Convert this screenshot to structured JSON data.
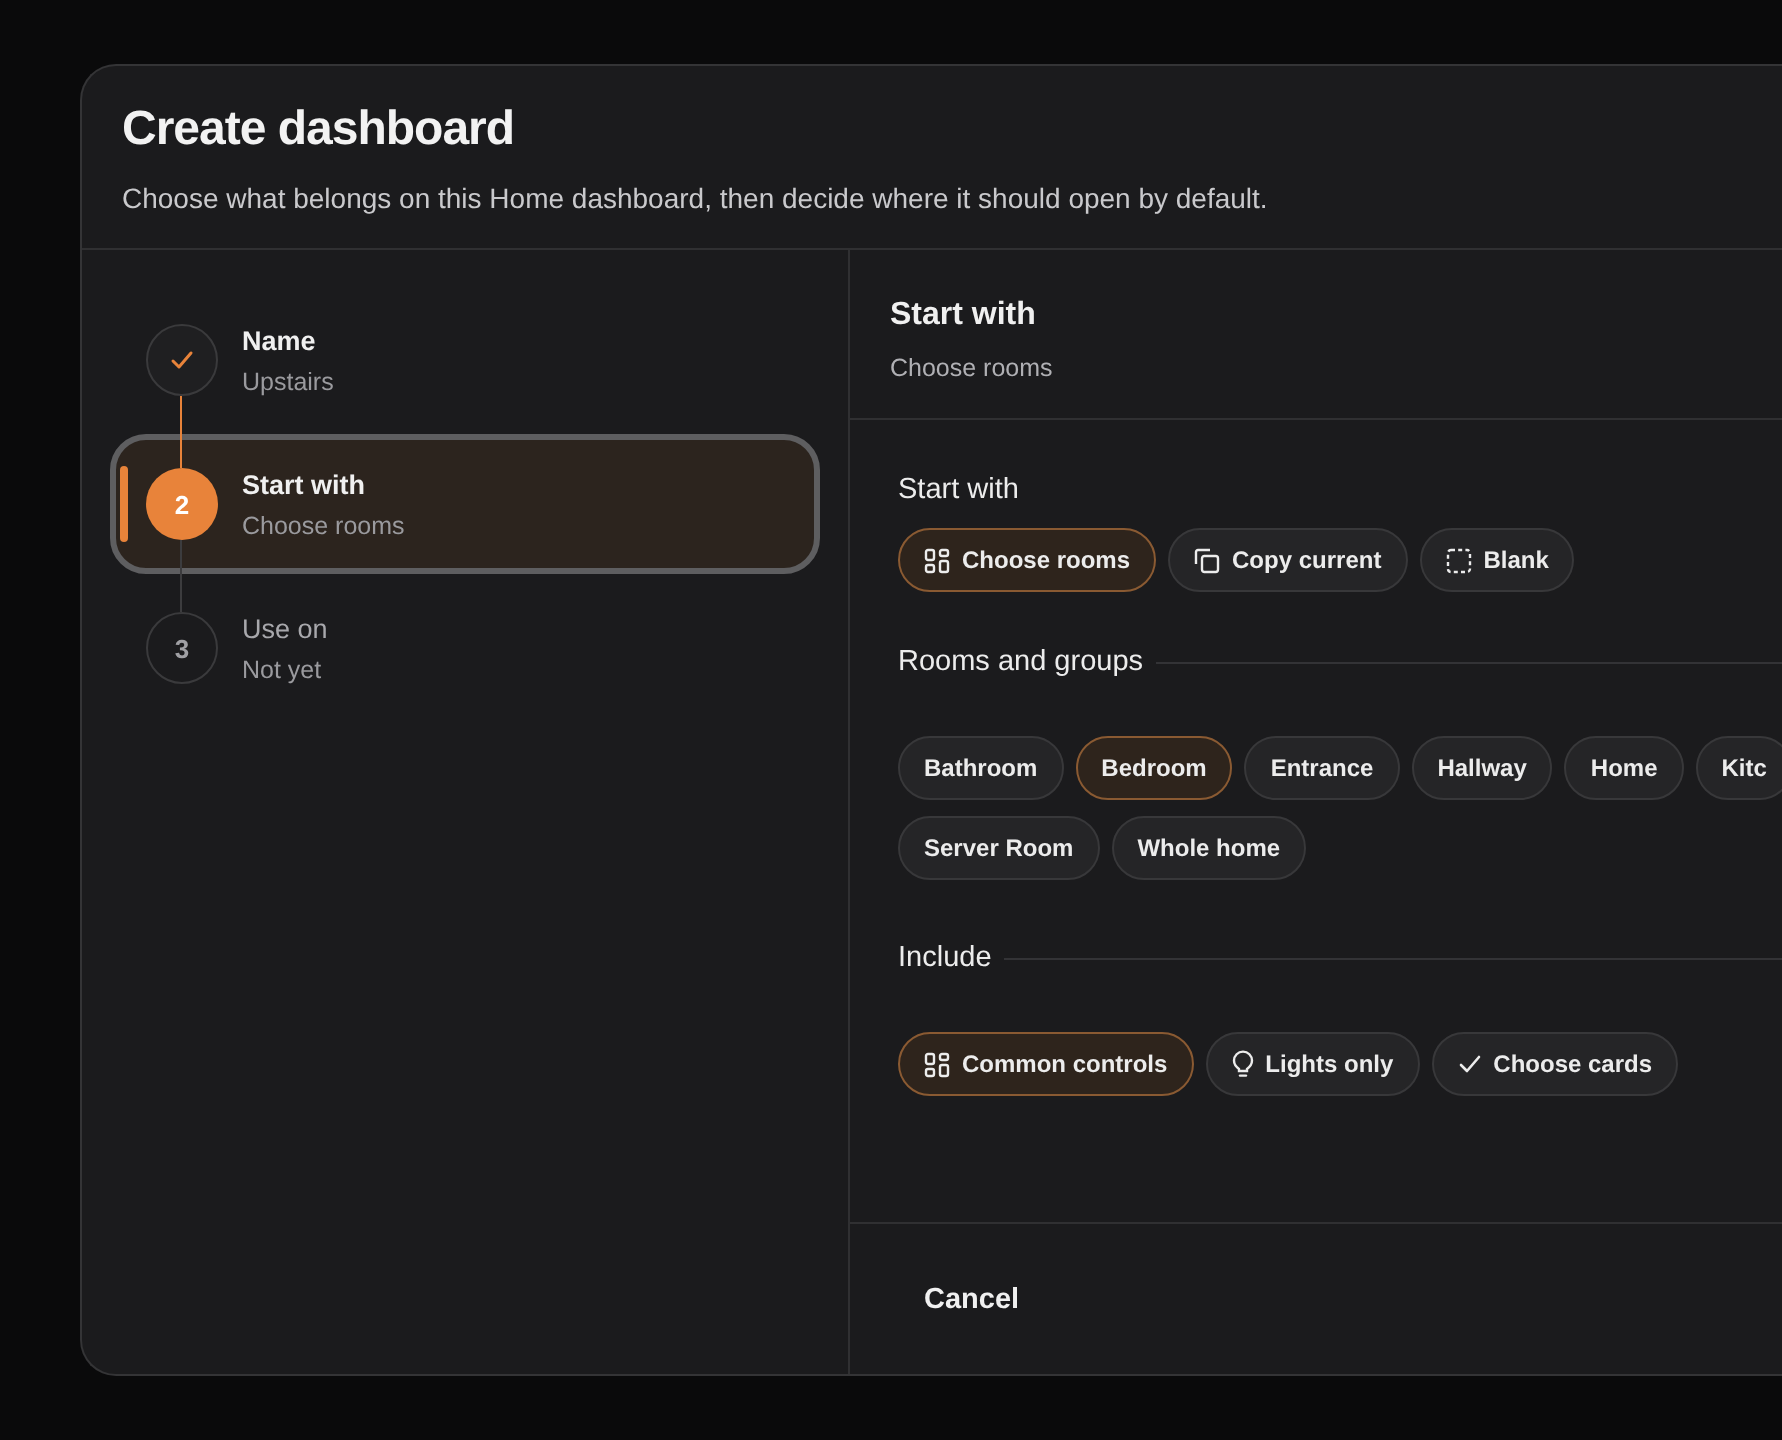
{
  "dialog": {
    "title": "Create dashboard",
    "subtitle": "Choose what belongs on this Home dashboard, then decide where it should open by default."
  },
  "steps": [
    {
      "title": "Name",
      "subtitle": "Upstairs",
      "kind": "done",
      "selected": false
    },
    {
      "number": "2",
      "title": "Start with",
      "subtitle": "Choose rooms",
      "kind": "current",
      "selected": true
    },
    {
      "number": "3",
      "title": "Use on",
      "subtitle": "Not yet",
      "kind": "pending",
      "selected": false
    }
  ],
  "panel": {
    "title": "Start with",
    "subtitle": "Choose rooms"
  },
  "sections": [
    {
      "title": "Start with",
      "divider": false,
      "options": [
        {
          "label": "Choose rooms",
          "kind": "grid",
          "selected": true
        },
        {
          "label": "Copy current",
          "kind": "copy",
          "selected": false
        },
        {
          "label": "Blank",
          "kind": "dashed",
          "selected": false
        }
      ]
    },
    {
      "title": "Rooms and groups",
      "divider": true,
      "options": [
        {
          "label": "Bathroom",
          "kind": "plain",
          "selected": false
        },
        {
          "label": "Bedroom",
          "kind": "plain",
          "selected": true
        },
        {
          "label": "Entrance",
          "kind": "plain",
          "selected": false
        },
        {
          "label": "Hallway",
          "kind": "plain",
          "selected": false
        },
        {
          "label": "Home",
          "kind": "plain",
          "selected": false
        },
        {
          "label": "Kitc",
          "kind": "plain",
          "selected": false
        },
        {
          "label": "Server Room",
          "kind": "plain",
          "selected": false
        },
        {
          "label": "Whole home",
          "kind": "plain",
          "selected": false
        }
      ]
    },
    {
      "title": "Include",
      "divider": true,
      "options": [
        {
          "label": "Common controls",
          "kind": "grid",
          "selected": true
        },
        {
          "label": "Lights only",
          "kind": "bulb",
          "selected": false
        },
        {
          "label": "Choose cards",
          "kind": "check",
          "selected": false
        }
      ]
    }
  ],
  "footer": {
    "cancel": "Cancel"
  }
}
